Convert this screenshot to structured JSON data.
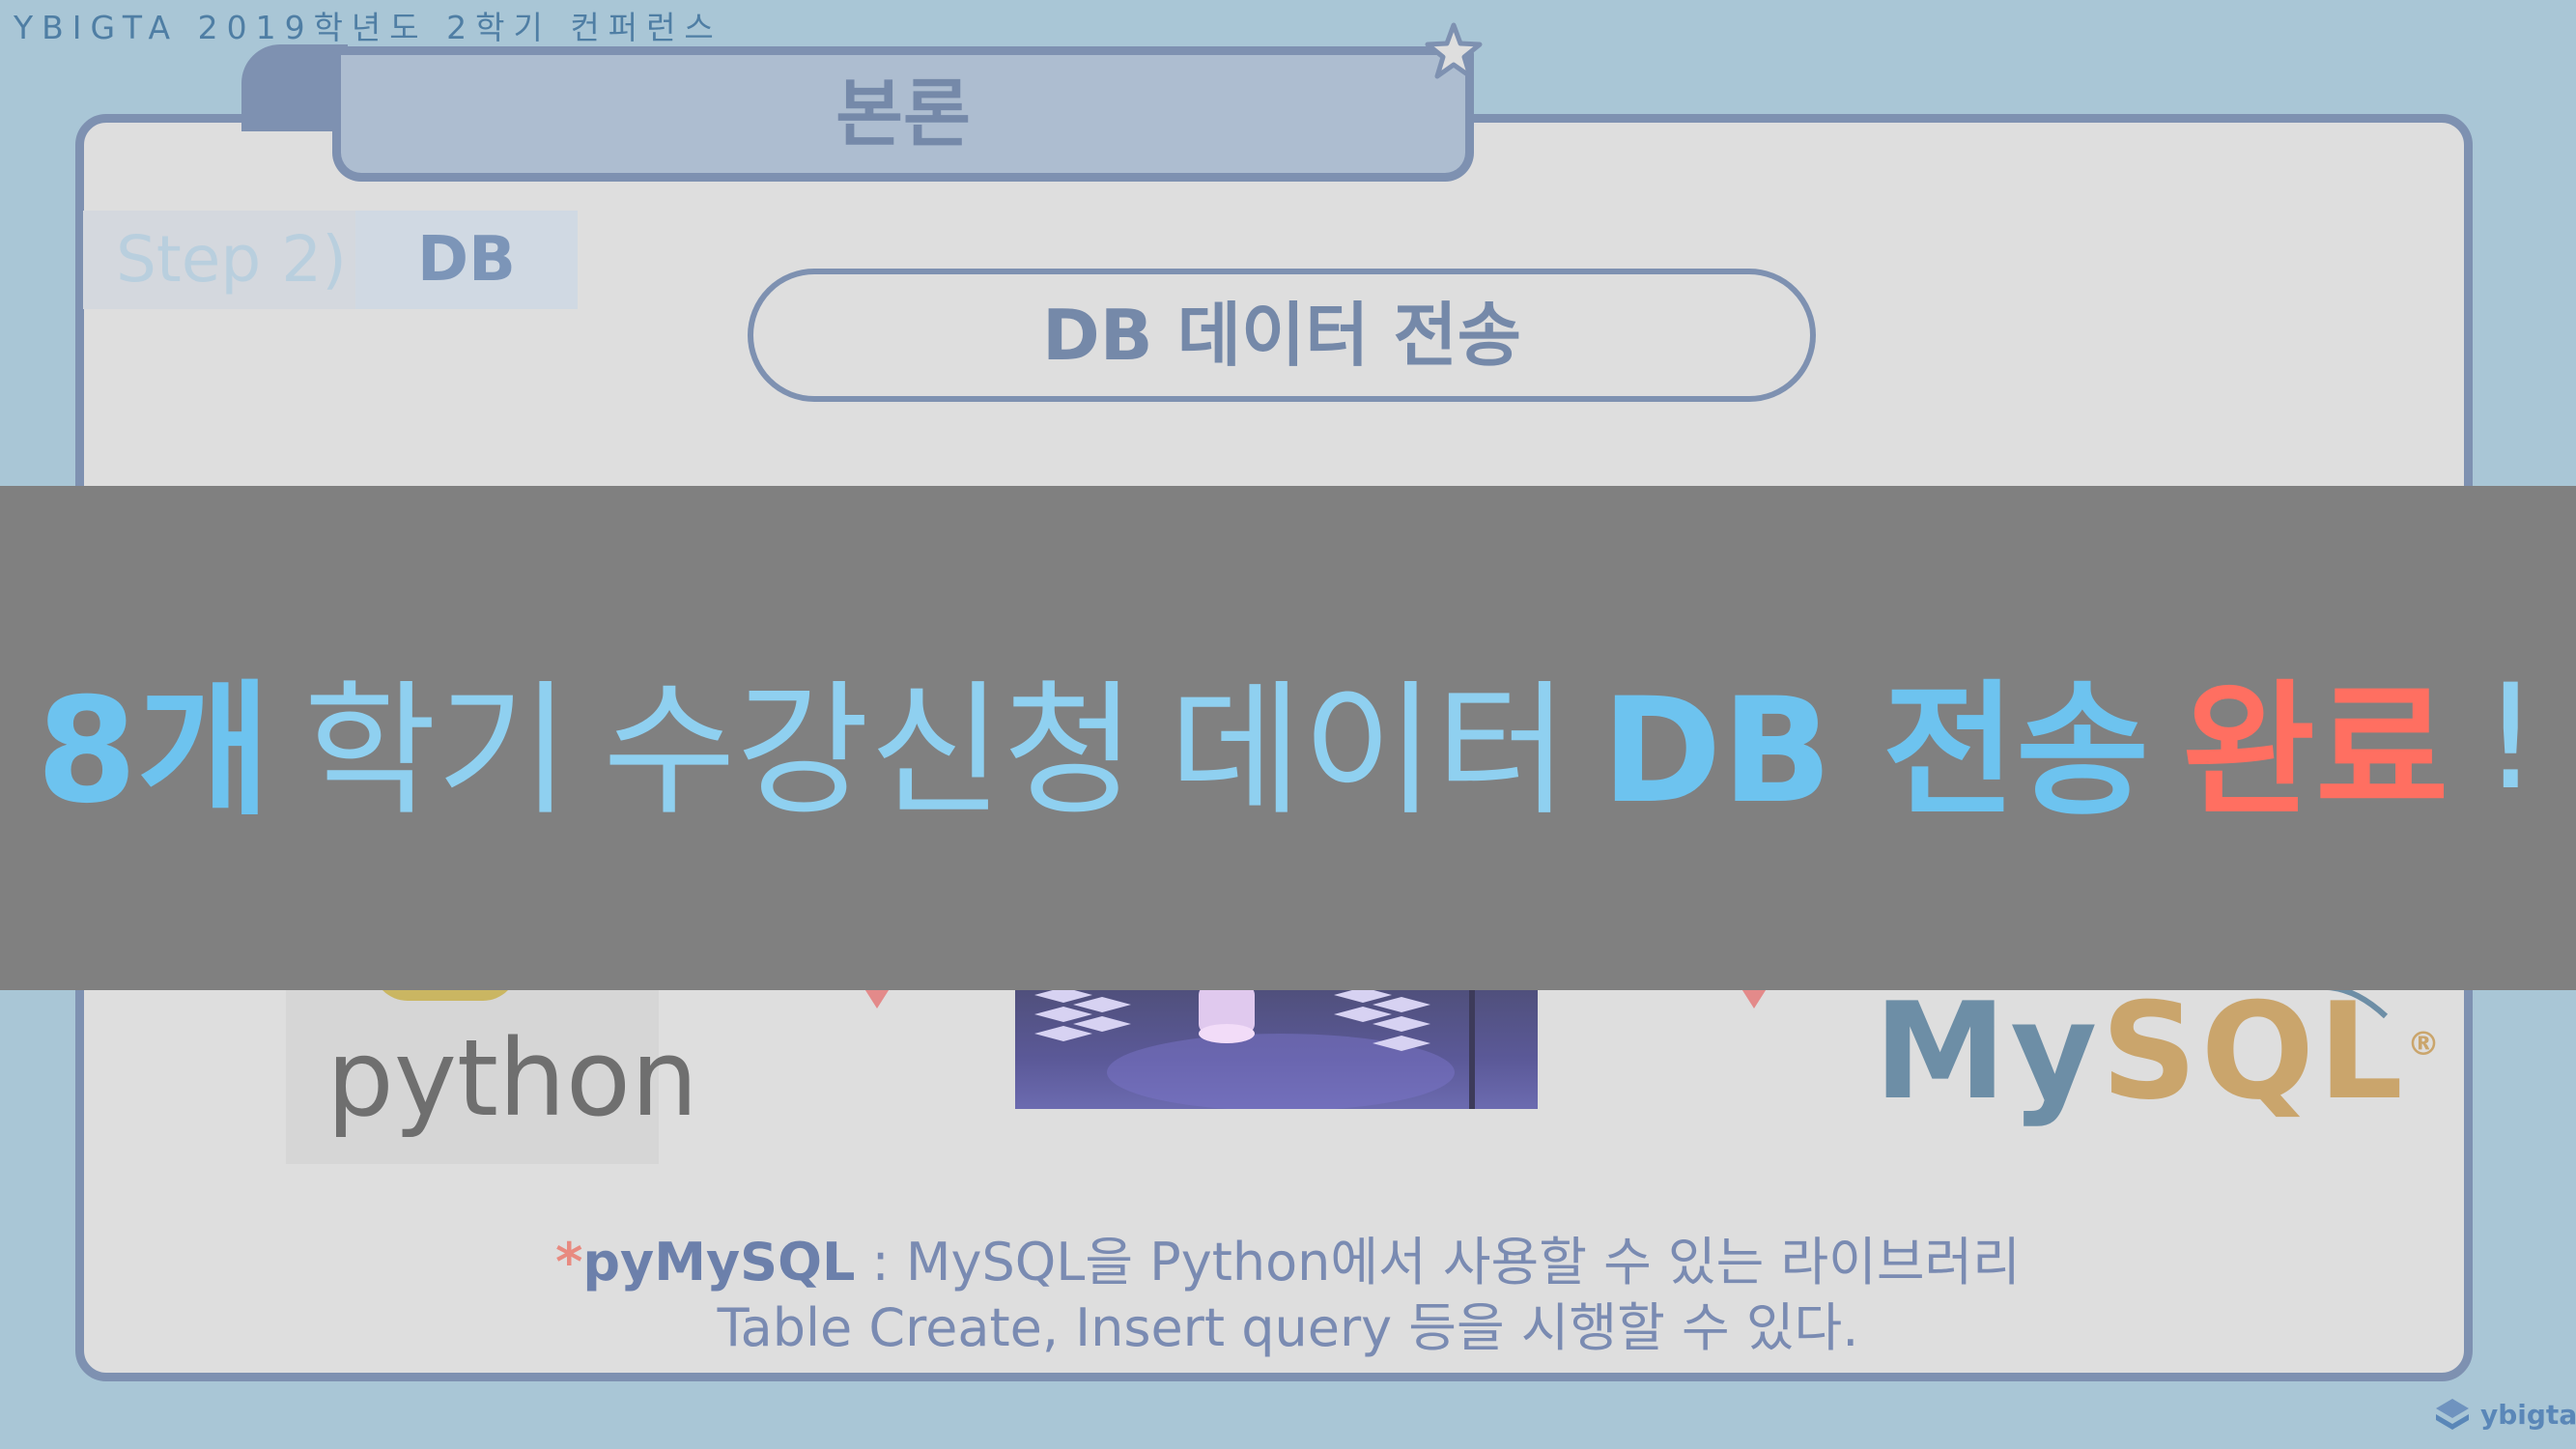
{
  "header": {
    "conference": "YBIGTA 2019학년도 2학기 컨퍼런스"
  },
  "section": {
    "title": "본론"
  },
  "step": {
    "label": "Step 2)",
    "value": "DB"
  },
  "pill": {
    "title": "DB 데이터 전송"
  },
  "images": {
    "python": "python",
    "mysql_my": "My",
    "mysql_sql": "SQL",
    "mysql_reg": "®"
  },
  "note": {
    "star": "*",
    "bold": "pyMySQL",
    "line1_rest": " : MySQL을 Python에서 사용할 수 있는 라이브러리",
    "line2": "Table Create, Insert query 등을 시행할 수 있다."
  },
  "overlay": {
    "part1": "8개",
    "part2": "학기",
    "part3": "수강신청",
    "part4": "데이터",
    "part5": "DB 전송",
    "part6": "완료",
    "part7": "!"
  },
  "logo": {
    "text": "ybigta"
  },
  "colors": {
    "background": "#a9c6d6",
    "panel": "#dedede",
    "border": "#7e91b1",
    "overlay": "#808080",
    "highlight_blue": "#6dc3ef",
    "highlight_red": "#ff6f61"
  }
}
